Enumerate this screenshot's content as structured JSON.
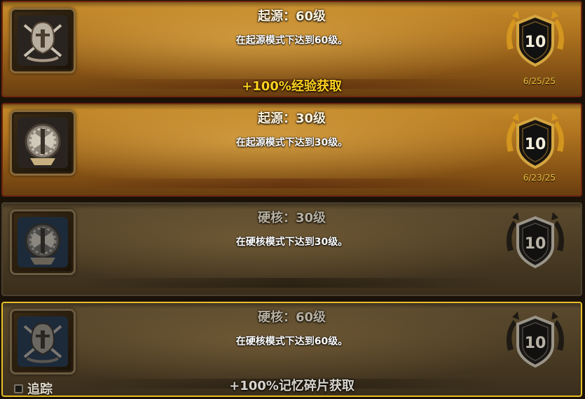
{
  "achievements": [
    {
      "title": "起源：60级",
      "description": "在起源模式下达到60级。",
      "reward": "+100%经验获取",
      "points": "10",
      "date": "6/25/25",
      "completed": true,
      "icon": "helmet-crossed-swords-icon"
    },
    {
      "title": "起源：30级",
      "description": "在起源模式下达到30级。",
      "reward": "",
      "points": "10",
      "date": "6/23/25",
      "completed": true,
      "icon": "axe-wreath-icon"
    },
    {
      "title": "硬核：30级",
      "description": "在硬核模式下达到30级。",
      "reward": "",
      "points": "10",
      "date": "",
      "completed": false,
      "icon": "axe-wreath-icon"
    },
    {
      "title": "硬核：60级",
      "description": "在硬核模式下达到60级。",
      "reward": "+100%记忆碎片获取",
      "points": "10",
      "date": "",
      "completed": false,
      "icon": "helmet-crossed-swords-icon"
    }
  ],
  "track": {
    "label": "追踪",
    "checked": false
  },
  "colors": {
    "completed_border": "#6e2410",
    "selected_border": "#e8c028",
    "reward_gold": "#ffd21e",
    "date_gold": "#f2c13a"
  }
}
